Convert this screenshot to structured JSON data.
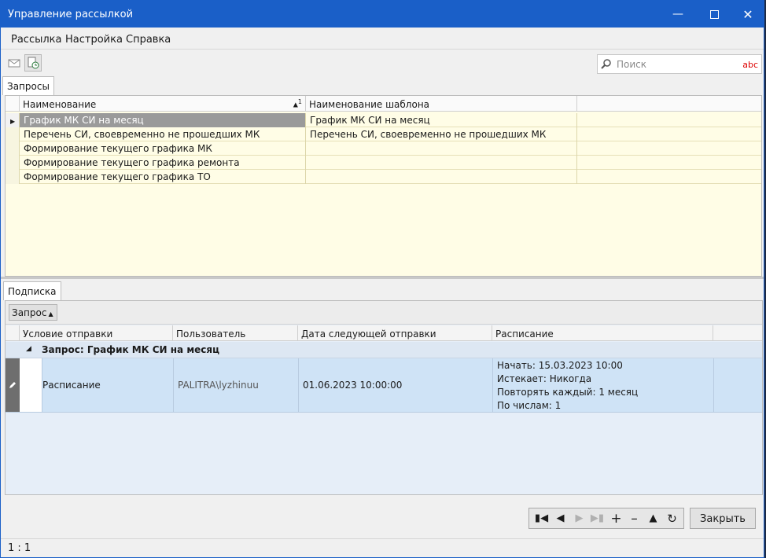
{
  "window": {
    "title": "Управление рассылкой"
  },
  "menu": [
    "Рассылка",
    "Настройка",
    "Справка"
  ],
  "search": {
    "placeholder": "Поиск",
    "spell_label": "abc"
  },
  "requests": {
    "tab": "Запросы",
    "columns": [
      "Наименование",
      "Наименование шаблона"
    ],
    "sort_indicator": "1",
    "rows": [
      [
        "График МК СИ на месяц",
        "График МК СИ на месяц"
      ],
      [
        "Перечень СИ, своевременно не прошедших МК",
        "Перечень СИ, своевременно не прошедших МК"
      ],
      [
        "Формирование текущего графика МК",
        ""
      ],
      [
        "Формирование текущего графика ремонта",
        ""
      ],
      [
        "Формирование текущего графика ТО",
        ""
      ]
    ]
  },
  "subscription": {
    "tab": "Подписка",
    "group_by_button": "Запрос",
    "columns": [
      "Условие отправки",
      "Пользователь",
      "Дата следующей отправки",
      "Расписание"
    ],
    "group_label": "Запрос: График МК СИ на месяц",
    "row": {
      "condition": "Расписание",
      "user": "PALITRA\\lyzhinuu",
      "next_date": "01.06.2023 10:00:00",
      "schedule": [
        "Начать: 15.03.2023 10:00",
        "Истекает: Никогда",
        "Повторять каждый: 1 месяц",
        "По числам: 1"
      ]
    }
  },
  "footer": {
    "close_label": "Закрыть",
    "status": "1 : 1"
  },
  "colors": {
    "titlebar": "#1a5fc8",
    "grid_bg": "#fffde6",
    "sub_bg": "#e6eef8",
    "selected_row": "#9a9a9a"
  }
}
